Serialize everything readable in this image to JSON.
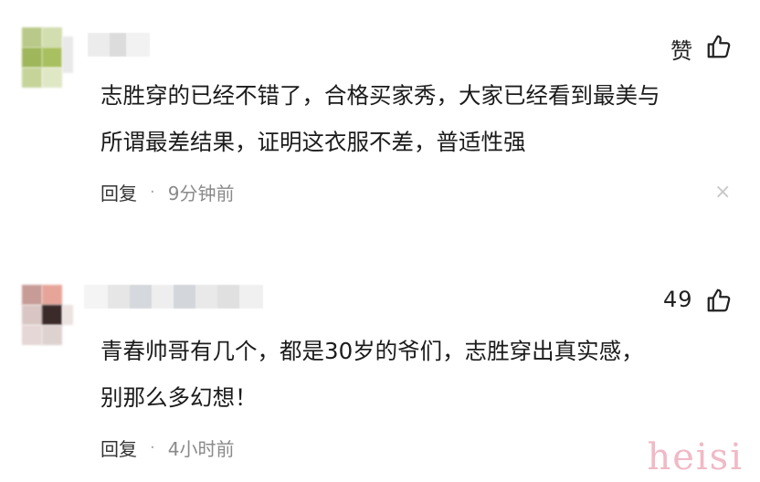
{
  "comments": [
    {
      "likes": "赞",
      "text": "志胜穿的已经不错了，合格买家秀，大家已经看到最美与\n所谓最差结果，证明这衣服不差，普适性强",
      "reply_label": "回复",
      "separator": "·",
      "time": "9分钟前",
      "has_close": true
    },
    {
      "likes": "49",
      "text": "青春帅哥有几个，都是30岁的爷们，志胜穿出真实感，\n别那么多幻想！",
      "reply_label": "回复",
      "separator": "·",
      "time": "4小时前",
      "has_close": false
    }
  ],
  "close_glyph": "×",
  "watermark": "heisi",
  "icons": {
    "like": "thumbs-up-icon",
    "close": "close-icon"
  },
  "colors": {
    "text": "#1b1b1b",
    "meta": "#8a8a8a",
    "watermark": "#f1b9c6"
  }
}
